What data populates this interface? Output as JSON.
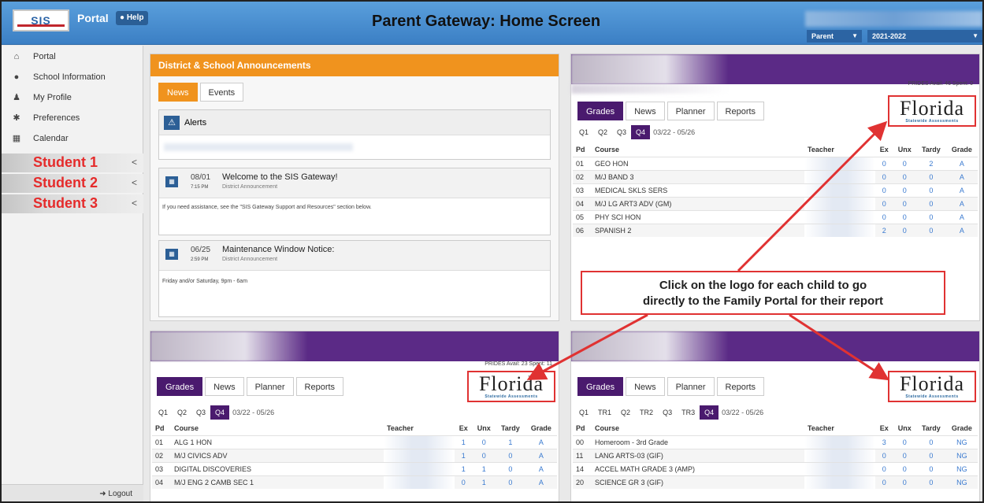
{
  "header": {
    "logo": "SIS",
    "portal": "Portal",
    "help": "Help",
    "title": "Parent Gateway: Home Screen",
    "role": "Parent",
    "year": "2021-2022"
  },
  "sidebar": {
    "items": [
      {
        "label": "Portal",
        "icon": "home-icon"
      },
      {
        "label": "School Information",
        "icon": "info-icon"
      },
      {
        "label": "My Profile",
        "icon": "user-icon"
      },
      {
        "label": "Preferences",
        "icon": "gear-icon"
      },
      {
        "label": "Calendar",
        "icon": "calendar-icon"
      }
    ],
    "students": [
      "Student 1",
      "Student 2",
      "Student 3"
    ],
    "logout": "Logout"
  },
  "announcements": {
    "title": "District & School Announcements",
    "tabs": [
      "News",
      "Events"
    ],
    "alerts": "Alerts",
    "posts": [
      {
        "date": "08/01",
        "time": "7:15 PM",
        "title": "Welcome to the SIS Gateway!",
        "sub": "District Announcement",
        "body": "If you need assistance, see the \"SIS Gateway Support and Resources\" section below."
      },
      {
        "date": "06/25",
        "time": "2:59 PM",
        "title": "Maintenance Window Notice:",
        "sub": "District Announcement",
        "body": "Friday and/or Saturday, 9pm - 6am"
      }
    ]
  },
  "logo": {
    "big": "Florida",
    "small": "Statewide Assessments"
  },
  "card_tabs": [
    "Grades",
    "News",
    "Planner",
    "Reports"
  ],
  "columns": [
    "Pd",
    "Course",
    "Teacher",
    "Ex",
    "Unx",
    "Tardy",
    "Grade"
  ],
  "cards": [
    {
      "prides": "PRIDES Avail: 46  Spent: 0",
      "quarters": [
        "Q1",
        "Q2",
        "Q3",
        "Q4"
      ],
      "range": "03/22 - 05/26",
      "rows": [
        [
          "01",
          "GEO HON",
          "0",
          "0",
          "2",
          "A"
        ],
        [
          "02",
          "M/J BAND 3",
          "0",
          "0",
          "0",
          "A"
        ],
        [
          "03",
          "MEDICAL SKLS SERS",
          "0",
          "0",
          "0",
          "A"
        ],
        [
          "04",
          "M/J LG ART3 ADV (GM)",
          "0",
          "0",
          "0",
          "A"
        ],
        [
          "05",
          "PHY SCI HON",
          "0",
          "0",
          "0",
          "A"
        ],
        [
          "06",
          "SPANISH 2",
          "2",
          "0",
          "0",
          "A"
        ]
      ]
    },
    {
      "prides": "PRIDES Avail: 23  Spent: 11",
      "quarters": [
        "Q1",
        "Q2",
        "Q3",
        "Q4"
      ],
      "range": "03/22 - 05/26",
      "rows": [
        [
          "01",
          "ALG 1 HON",
          "1",
          "0",
          "1",
          "A"
        ],
        [
          "02",
          "M/J CIVICS ADV",
          "1",
          "0",
          "0",
          "A"
        ],
        [
          "03",
          "DIGITAL DISCOVERIES",
          "1",
          "1",
          "0",
          "A"
        ],
        [
          "04",
          "M/J ENG 2 CAMB SEC 1",
          "0",
          "1",
          "0",
          "A"
        ]
      ]
    },
    {
      "prides": "",
      "quarters": [
        "Q1",
        "TR1",
        "Q2",
        "TR2",
        "Q3",
        "TR3",
        "Q4"
      ],
      "range": "03/22 - 05/26",
      "rows": [
        [
          "00",
          "Homeroom - 3rd Grade",
          "3",
          "0",
          "0",
          "NG"
        ],
        [
          "11",
          "LANG ARTS-03 (GIF)",
          "0",
          "0",
          "0",
          "NG"
        ],
        [
          "14",
          "ACCEL MATH GRADE 3 (AMP)",
          "0",
          "0",
          "0",
          "NG"
        ],
        [
          "20",
          "SCIENCE GR 3 (GIF)",
          "0",
          "0",
          "0",
          "NG"
        ]
      ]
    }
  ],
  "callout": {
    "line1": "Click on the logo for each child to go",
    "line2": "directly to the Family Portal for their report"
  },
  "colors": {
    "blue": "#3b7fc4",
    "orange": "#f0931e",
    "purple": "#4a1a6e",
    "red": "#e03232"
  }
}
